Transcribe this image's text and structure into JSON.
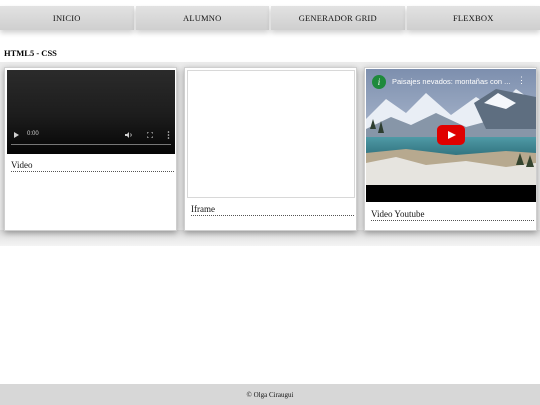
{
  "nav": {
    "items": [
      "INICIO",
      "ALUMNO",
      "GENERADOR GRID",
      "FLEXBOX"
    ]
  },
  "section_title": "HTML5 - CSS",
  "cards": {
    "video": {
      "label": "Video",
      "player": {
        "time": "0:00",
        "volume_icon": "volume-icon",
        "fullscreen_icon": "fullscreen-icon",
        "menu_icon": "more-vert-icon"
      }
    },
    "iframe": {
      "label": "Iframe"
    },
    "youtube": {
      "label": "Video Youtube",
      "video_title": "Paisajes nevados: montañas con ...",
      "channel_initial": "i",
      "play_color": "#e00000"
    }
  },
  "footer": {
    "text": "© Olga Ciraugui"
  }
}
